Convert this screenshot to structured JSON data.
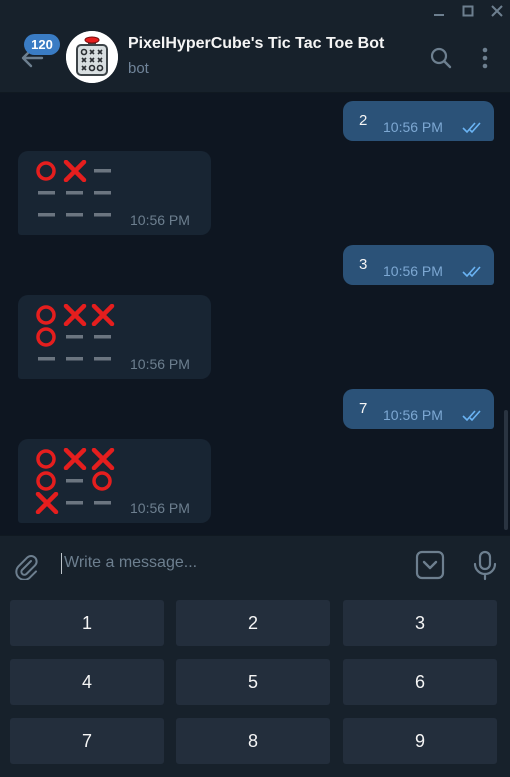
{
  "window": {
    "controls": [
      "minimize-icon",
      "maximize-icon",
      "close-icon"
    ]
  },
  "header": {
    "back_icon": "arrow-left-icon",
    "unread_count": "120",
    "title": "PixelHyperCube's Tic Tac Toe Bot",
    "subtitle": "bot",
    "search_icon": "search-icon",
    "menu_icon": "more-vertical-icon"
  },
  "messages": [
    {
      "type": "outgoing",
      "text": "2",
      "time": "10:56 PM",
      "status": "read"
    },
    {
      "type": "incoming",
      "board": [
        "O",
        "X",
        "-",
        "-",
        "-",
        "-",
        "-",
        "-",
        "-"
      ],
      "time": "10:56 PM"
    },
    {
      "type": "outgoing",
      "text": "3",
      "time": "10:56 PM",
      "status": "read"
    },
    {
      "type": "incoming",
      "board": [
        "O",
        "X",
        "X",
        "O",
        "-",
        "-",
        "-",
        "-",
        "-"
      ],
      "time": "10:56 PM"
    },
    {
      "type": "outgoing",
      "text": "7",
      "time": "10:56 PM",
      "status": "read"
    },
    {
      "type": "incoming",
      "board": [
        "O",
        "X",
        "X",
        "O",
        "-",
        "O",
        "X",
        "-",
        "-"
      ],
      "time": "10:56 PM"
    }
  ],
  "compose": {
    "placeholder": "Write a message...",
    "value": "",
    "attach_icon": "paperclip-icon",
    "keyboard_icon": "keyboard-toggle-icon",
    "mic_icon": "microphone-icon"
  },
  "keyboard": {
    "rows": [
      [
        "1",
        "2",
        "3"
      ],
      [
        "4",
        "5",
        "6"
      ],
      [
        "7",
        "8",
        "9"
      ]
    ]
  },
  "colors": {
    "background": "#0e1621",
    "panel": "#17212b",
    "outgoing_bubble": "#2b5278",
    "incoming_bubble": "#182533",
    "key": "#232e3c",
    "accent": "#3a7cc4",
    "x_mark": "#e51e1e",
    "o_mark": "#e51e1e",
    "empty_mark": "#6b7580",
    "read_ticks": "#6ab3f3"
  }
}
